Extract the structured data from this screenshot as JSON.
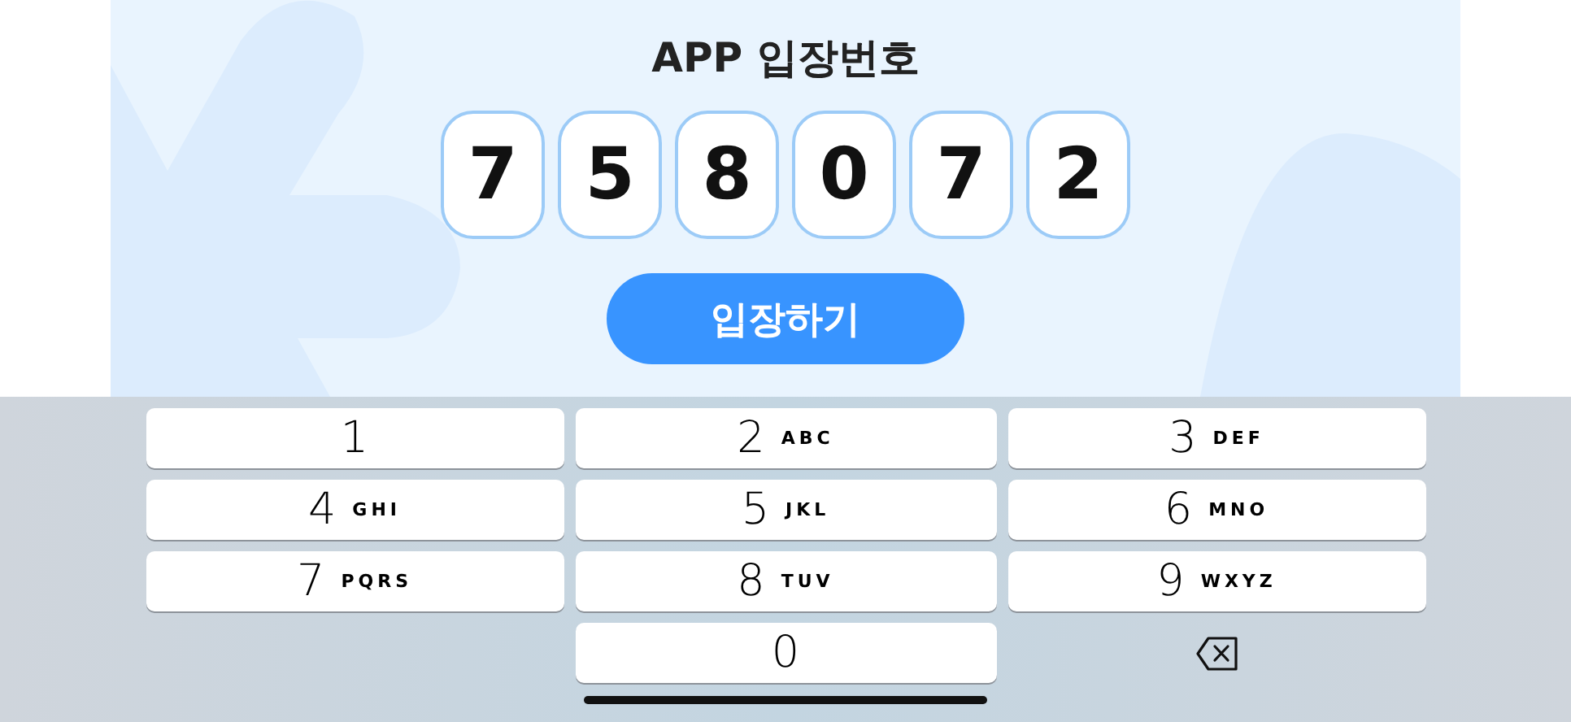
{
  "title": "APP 입장번호",
  "code_digits": [
    "7",
    "5",
    "8",
    "0",
    "7",
    "2"
  ],
  "enter_button": "입장하기",
  "keypad": [
    {
      "kind": "digit",
      "digit": "1"
    },
    {
      "kind": "digit",
      "digit": "2",
      "letters": "ABC"
    },
    {
      "kind": "digit",
      "digit": "3",
      "letters": "DEF"
    },
    {
      "kind": "digit",
      "digit": "4",
      "letters": "GHI"
    },
    {
      "kind": "digit",
      "digit": "5",
      "letters": "JKL"
    },
    {
      "kind": "digit",
      "digit": "6",
      "letters": "MNO"
    },
    {
      "kind": "digit",
      "digit": "7",
      "letters": "PQRS"
    },
    {
      "kind": "digit",
      "digit": "8",
      "letters": "TUV"
    },
    {
      "kind": "digit",
      "digit": "9",
      "letters": "WXYZ"
    },
    {
      "kind": "digit",
      "digit": "0"
    },
    {
      "kind": "delete"
    }
  ]
}
